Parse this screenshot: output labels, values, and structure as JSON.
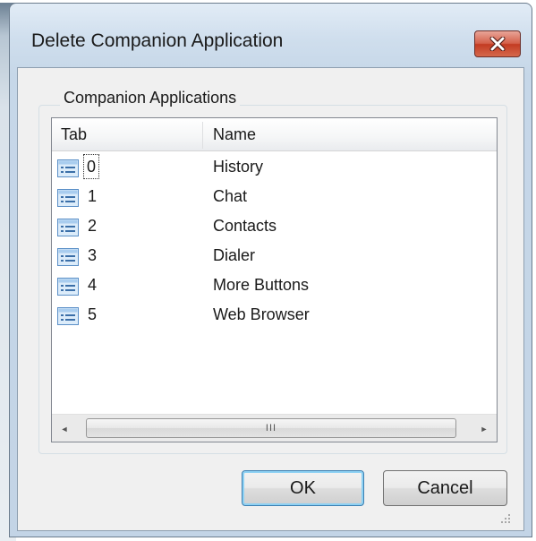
{
  "dialog": {
    "title": "Delete Companion Application",
    "close_icon": "close-x-icon",
    "accent_color": "#c33b22"
  },
  "group": {
    "label": "Companion Applications"
  },
  "list": {
    "columns": [
      "Tab",
      "Name"
    ],
    "rows": [
      {
        "tab": "0",
        "name": "History"
      },
      {
        "tab": "1",
        "name": "Chat"
      },
      {
        "tab": "2",
        "name": "Contacts"
      },
      {
        "tab": "3",
        "name": "Dialer"
      },
      {
        "tab": "4",
        "name": "More Buttons"
      },
      {
        "tab": "5",
        "name": "Web Browser"
      }
    ],
    "row_icon": "list-item-icon",
    "focused_row": 0,
    "scrollbar": {
      "left_arrow": "◄",
      "right_arrow": "►",
      "thumb_grip": "III"
    }
  },
  "buttons": {
    "ok_label": "OK",
    "cancel_label": "Cancel"
  }
}
